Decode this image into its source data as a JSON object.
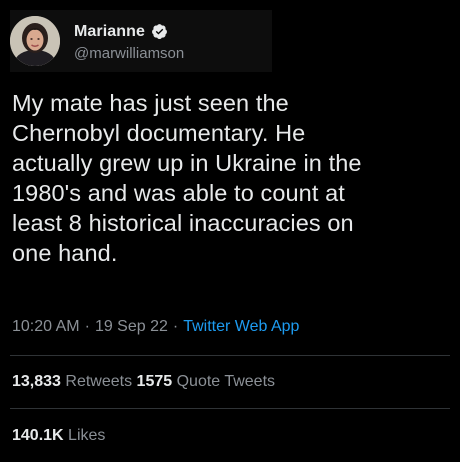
{
  "author": {
    "display_name": "Marianne",
    "handle": "@marwilliamson",
    "verified_icon": "verified-badge-icon",
    "avatar_icon": "avatar-photo"
  },
  "tweet": {
    "text_lines": [
      "My mate has just seen the",
      "Chernobyl documentary. He",
      "actually grew up in Ukraine in the",
      "1980's and was able to count at",
      "least 8 historical inaccuracies on",
      "one hand."
    ]
  },
  "meta": {
    "time": "10:20 AM",
    "separator": "·",
    "date": "19 Sep 22",
    "app": "Twitter Web App"
  },
  "stats": {
    "retweets_count": "13,833",
    "retweets_label": "Retweets",
    "quotes_count": "1575",
    "quotes_label": "Quote Tweets",
    "likes_count": "140.1K",
    "likes_label": "Likes"
  },
  "colors": {
    "background": "#000000",
    "text": "#e7e9ea",
    "secondary": "#8b9096",
    "link": "#1d9bf0",
    "divider": "#2f3336",
    "verified": "#1d9bf0"
  }
}
